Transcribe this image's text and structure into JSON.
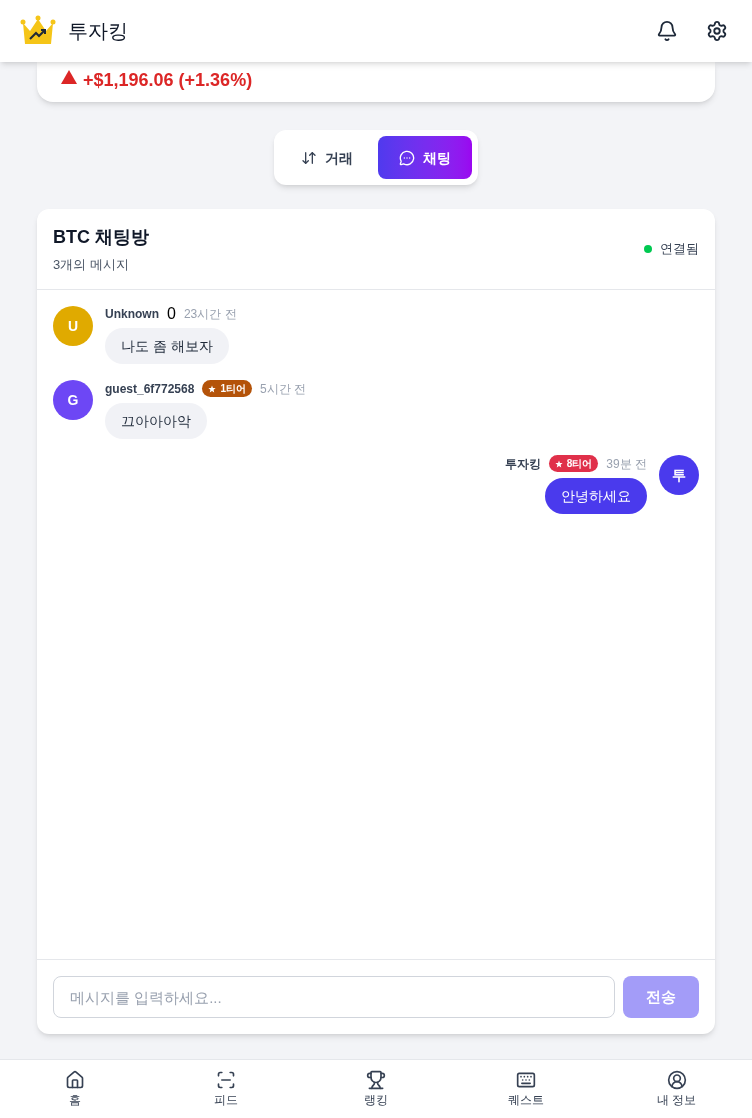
{
  "app": {
    "title": "투자킹"
  },
  "summary": {
    "change": "+$1,196.06 (+1.36%)"
  },
  "tabs": [
    {
      "label": "거래",
      "kind": "trade",
      "selected": false
    },
    {
      "label": "채팅",
      "kind": "chat",
      "selected": true
    }
  ],
  "chat": {
    "title": "BTC 채팅방",
    "count": "3개의 메시지",
    "status": "연결됨",
    "connected": true,
    "messages": [
      {
        "avatar": "U",
        "color": "#e0aa00",
        "name": "Unknown",
        "extra": "0",
        "time": "23시간 전",
        "text": "나도 좀 해보자",
        "mine": false
      },
      {
        "avatar": "G",
        "color": "#6d47f5",
        "name": "guest_6f772568",
        "tier": {
          "label": "1티어",
          "color": "#b45309"
        },
        "time": "5시간 전",
        "text": "끄아아아악",
        "mine": false
      },
      {
        "avatar": "투",
        "color": "#4a3aed",
        "name": "투자킹",
        "tier": {
          "label": "8티어",
          "color": "#e0304a"
        },
        "time": "39분 전",
        "text": "안녕하세요",
        "mine": true
      }
    ],
    "input": {
      "placeholder": "메시지를 입력하세요..."
    },
    "send": "전송"
  },
  "nav": [
    {
      "label": "홈",
      "kind": "home"
    },
    {
      "label": "피드",
      "kind": "feed"
    },
    {
      "label": "랭킹",
      "kind": "ranking"
    },
    {
      "label": "퀘스트",
      "kind": "quest"
    },
    {
      "label": "내 정보",
      "kind": "profile"
    }
  ]
}
